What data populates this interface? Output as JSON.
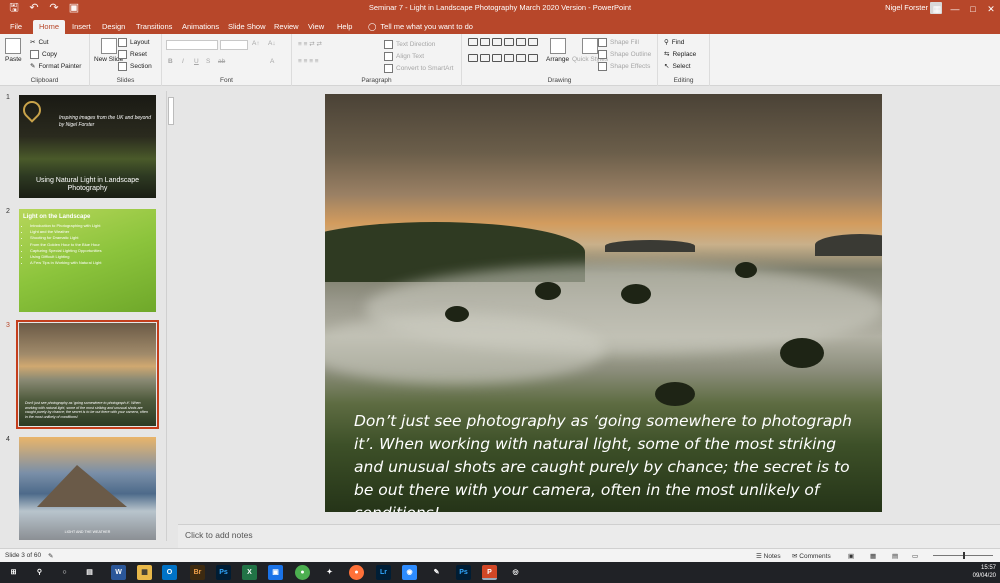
{
  "titlebar": {
    "document_title": "Seminar 7 -  Light in Landscape Photography March 2020 Version  -  PowerPoint",
    "user_name": "Nigel Forster",
    "qat_icons": [
      "save-icon",
      "undo-icon",
      "redo-icon",
      "slideshow-icon"
    ],
    "window_controls": [
      "restore-ribbon-icon",
      "minimize-icon",
      "maximize-icon",
      "close-icon"
    ]
  },
  "tabs": [
    "File",
    "Home",
    "Insert",
    "Design",
    "Transitions",
    "Animations",
    "Slide Show",
    "Review",
    "View",
    "Help"
  ],
  "active_tab": "Home",
  "tellme": "Tell me what you want to do",
  "ribbon": {
    "clipboard": {
      "label": "Clipboard",
      "paste": "Paste",
      "cut": "Cut",
      "copy": "Copy",
      "format_painter": "Format Painter"
    },
    "slides": {
      "label": "Slides",
      "new_slide": "New Slide",
      "layout": "Layout",
      "reset": "Reset",
      "section": "Section"
    },
    "font": {
      "label": "Font",
      "bold": "B",
      "italic": "I",
      "underline": "U",
      "strike": "S",
      "shadow": "ab"
    },
    "paragraph": {
      "label": "Paragraph",
      "text_direction": "Text Direction",
      "align_text": "Align Text",
      "convert_smartart": "Convert to SmartArt"
    },
    "drawing": {
      "label": "Drawing",
      "arrange": "Arrange",
      "quick_styles": "Quick Styles",
      "shape_fill": "Shape Fill",
      "shape_outline": "Shape Outline",
      "shape_effects": "Shape Effects"
    },
    "editing": {
      "label": "Editing",
      "find": "Find",
      "replace": "Replace",
      "select": "Select"
    }
  },
  "thumbnails": [
    {
      "num": "1",
      "subtitle": "Inspiring images from the UK and beyond by Nigel Forster",
      "title": "Using Natural Light in Landscape Photography"
    },
    {
      "num": "2",
      "heading": "Light on the Landscape",
      "bullets": [
        "Introduction to Photographing with Light",
        "Light and the Weather",
        "Shooting for Dramatic Light",
        "From the Golden Hour to the Blue Hour",
        "Capturing Special Lighting Opportunities",
        "Using Difficult Lighting",
        "A Few Tips in Working with Natural Light"
      ]
    },
    {
      "num": "3",
      "caption": "Don't just see photography as 'going somewhere to photograph it'. When working with natural light, some of the most striking and unusual shots are caught purely by chance; the secret is to be out there with your camera, often in the most unlikely of conditions!"
    },
    {
      "num": "4",
      "caption": "LIGHT AND THE WEATHER"
    }
  ],
  "selected_slide": "3",
  "slide": {
    "caption": "Don’t just see photography as ‘going somewhere to photograph it’. When working with natural light, some of the most striking and unusual shots are caught purely by chance; the secret is to be out there with your camera, often in the most unlikely of conditions!"
  },
  "notes_placeholder": "Click to add notes",
  "status": {
    "slide_counter": "Slide 3 of 60",
    "notes": "Notes",
    "comments": "Comments"
  },
  "taskbar": {
    "apps": [
      "windows-start-icon",
      "search-icon",
      "cortana-icon",
      "task-view-icon",
      "word-icon",
      "file-explorer-icon",
      "outlook-icon",
      "bridge-icon",
      "photoshop-icon",
      "excel-icon",
      "photos-icon",
      "chrome-icon",
      "pin-app-icon",
      "firefox-icon",
      "lightroom-icon",
      "zoom-icon",
      "notes-app-icon",
      "photoshop-icon-2",
      "powerpoint-icon",
      "camera-app-icon"
    ],
    "time": "15:57",
    "date": "09/04/20"
  },
  "colors": {
    "accent": "#b7472a",
    "selection": "#c43e1c"
  }
}
